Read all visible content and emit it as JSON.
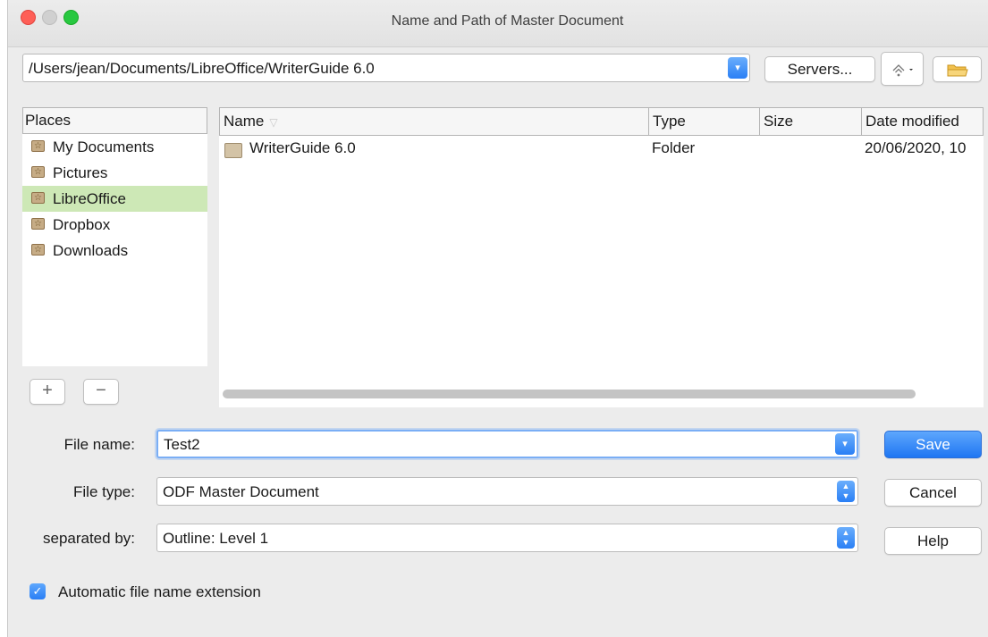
{
  "window": {
    "title": "Name and Path of Master Document"
  },
  "toolbar": {
    "path": "/Users/jean/Documents/LibreOffice/WriterGuide 6.0",
    "servers_label": "Servers...",
    "network_icon": "connect-to-server-icon",
    "new_folder_icon": "new-folder-icon"
  },
  "places": {
    "header": "Places",
    "items": [
      {
        "label": "My Documents",
        "selected": false
      },
      {
        "label": "Pictures",
        "selected": false
      },
      {
        "label": "LibreOffice",
        "selected": true
      },
      {
        "label": "Dropbox",
        "selected": false
      },
      {
        "label": "Downloads",
        "selected": false
      }
    ],
    "add_label": "+",
    "remove_label": "−"
  },
  "files": {
    "columns": {
      "name": "Name",
      "type": "Type",
      "size": "Size",
      "date": "Date modified"
    },
    "rows": [
      {
        "name": "WriterGuide 6.0",
        "type": "Folder",
        "size": "",
        "date": "20/06/2020, 10"
      }
    ]
  },
  "form": {
    "file_name_label": "File name:",
    "file_name_value": "Test2",
    "file_type_label": "File type:",
    "file_type_value": "ODF Master Document",
    "separated_by_label": "separated by:",
    "separated_by_value": "Outline: Level 1"
  },
  "buttons": {
    "save": "Save",
    "cancel": "Cancel",
    "help": "Help"
  },
  "options": {
    "auto_extension_label": "Automatic file name extension",
    "auto_extension_checked": true
  },
  "colors": {
    "accent": "#2a7ff5",
    "selection": "#cde8b6"
  }
}
